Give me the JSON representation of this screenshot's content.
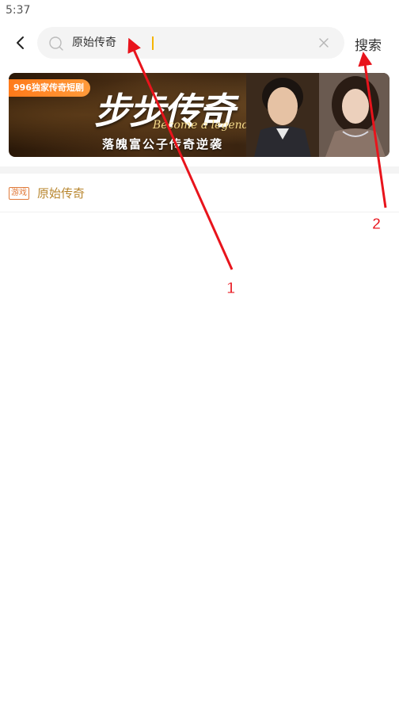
{
  "status_bar": {
    "time": "5:37"
  },
  "search": {
    "value": "原始传奇",
    "submit_label": "搜索"
  },
  "banner": {
    "badge": "996独家传奇短剧",
    "title": "步步传奇",
    "subtitle_en": "Become a legend",
    "subtitle": "落魄富公子传奇逆袭"
  },
  "results": [
    {
      "tag": "游戏",
      "label": "原始传奇"
    }
  ],
  "annotations": [
    {
      "label": "1"
    },
    {
      "label": "2"
    }
  ],
  "colors": {
    "accent": "#f5b400",
    "result_text": "#b8862e",
    "tag": "#e07a3a",
    "annotation_arrow": "#e8141c"
  }
}
